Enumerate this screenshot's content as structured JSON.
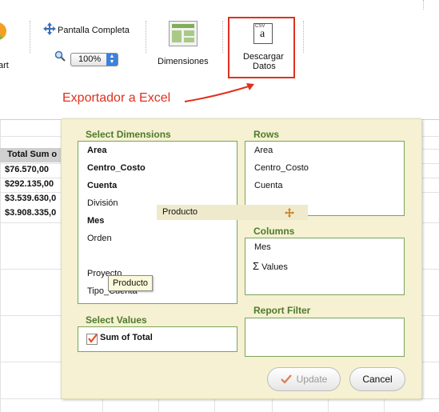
{
  "toolbar": {
    "partial_label": "art",
    "fullscreen_label": "Pantalla Completa",
    "zoom_value": "100%",
    "dimensions_label": "Dimensiones",
    "download_label_line1": "Descargar",
    "download_label_line2": "Datos",
    "csv_icon_text": "CSV"
  },
  "annotation": {
    "text": "Exportador a Excel",
    "color": "#e0301e"
  },
  "grid": {
    "header": "Total Sum o",
    "values": [
      "$76.570,00",
      "$292.135,00",
      "$3.539.630,0",
      "$3.908.335,0"
    ]
  },
  "dialog": {
    "select_dimensions_title": "Select Dimensions",
    "dimensions": [
      {
        "label": "Area",
        "bold": true
      },
      {
        "label": "Centro_Costo",
        "bold": true
      },
      {
        "label": "Cuenta",
        "bold": true
      },
      {
        "label": "División",
        "bold": false
      },
      {
        "label": "Mes",
        "bold": true
      },
      {
        "label": "Orden",
        "bold": false
      },
      {
        "label": "Proyecto",
        "bold": false
      },
      {
        "label": "Tipo_Cuenta",
        "bold": false
      }
    ],
    "rows_title": "Rows",
    "rows": [
      "Area",
      "Centro_Costo",
      "Cuenta"
    ],
    "columns_title": "Columns",
    "columns": [
      "Mes",
      "Values"
    ],
    "sigma": "Σ",
    "report_filter_title": "Report Filter",
    "select_values_title": "Select Values",
    "value_item": "Sum of Total",
    "value_checked": true,
    "update_label": "Update",
    "cancel_label": "Cancel",
    "drag_ghost_label": "Producto",
    "tooltip_label": "Producto"
  },
  "colors": {
    "accent_green": "#4e7a2c",
    "dialog_bg": "#f5f1d2",
    "highlight_red": "#e0301e"
  }
}
